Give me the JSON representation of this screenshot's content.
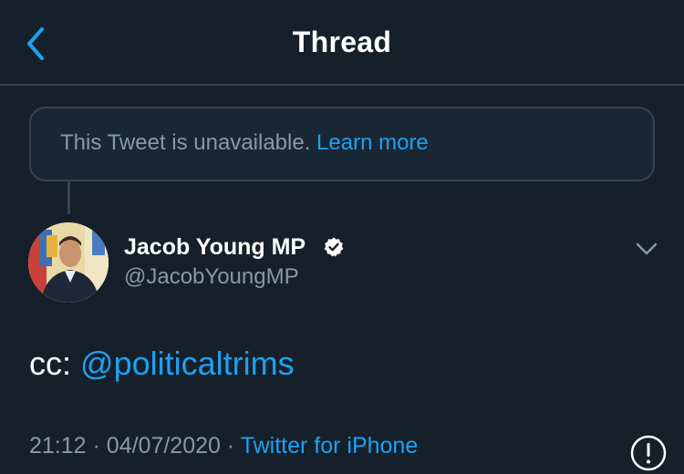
{
  "header": {
    "title": "Thread",
    "back_icon": "chevron-left-icon"
  },
  "unavailable": {
    "text": "This Tweet is unavailable.",
    "link": "Learn more"
  },
  "tweet": {
    "author_name": "Jacob Young MP",
    "author_handle": "@JacobYoungMP",
    "verified": true,
    "text_prefix": "cc:",
    "mention": "@politicaltrims",
    "time": "21:12",
    "separator": "·",
    "date": "04/07/2020",
    "source": "Twitter for iPhone"
  },
  "colors": {
    "background": "#15202b",
    "accent": "#1da1f2",
    "secondary_text": "#8899a6",
    "border": "#38444d"
  }
}
